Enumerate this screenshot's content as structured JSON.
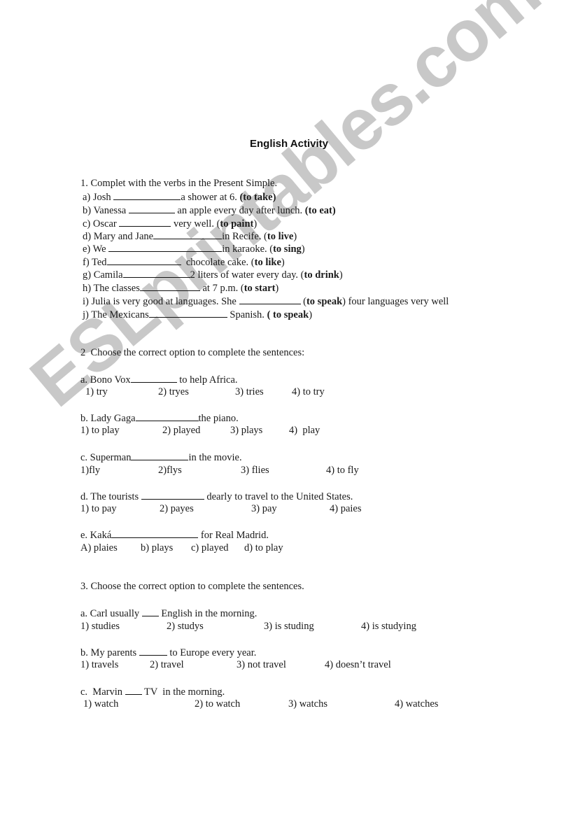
{
  "watermark": "ESLprintables.com",
  "title": "English Activity",
  "section1": {
    "instruction": "1. Complet with the verbs in the Present Simple.",
    "items": [
      {
        "label": "a) Josh ",
        "after": "a shower at 6. ",
        "hint": "(to take)"
      },
      {
        "label": "b) Vanessa ",
        "after": " an apple every day after lunch. ",
        "hint": "(to eat)"
      },
      {
        "label": "c) Oscar ",
        "after": " very well. (",
        "hint": "to paint",
        "close": ")"
      },
      {
        "label": "d) Mary and Jane",
        "after": "in Recife. (",
        "hint": "to live",
        "close": ")"
      },
      {
        "label": "e) We ",
        "after": "in karaoke. (",
        "hint": "to sing",
        "close": ")"
      },
      {
        "label": "f) Ted",
        "after": "  chocolate cake. (",
        "hint": "to like",
        "close": ")"
      },
      {
        "label": "g) Camila",
        "after": "2 liters of water every day. (",
        "hint": "to drink",
        "close": ")"
      },
      {
        "label": "h) The classes",
        "after": " at 7 p.m. (",
        "hint": "to start",
        "close": ")"
      },
      {
        "label": "i) Julia is very good at languages. She ",
        "after": " (",
        "hint": "to speak",
        "close": ") four languages very well"
      },
      {
        "label": "j) The Mexicans",
        "after": " Spanish. ",
        "hint": "( to speak",
        "close": ")"
      }
    ]
  },
  "section2": {
    "instruction": "2  Choose the correct option to complete the sentences:",
    "questions": [
      {
        "before": "a. Bono Vox",
        "after": " to help Africa.",
        "options": [
          "1) try",
          "2) tryes",
          "3) tries",
          "4) to try"
        ]
      },
      {
        "before": "b. Lady Gaga",
        "after": "the piano.",
        "options": [
          "1) to play",
          "2) played",
          "3) plays",
          "4)  play"
        ]
      },
      {
        "before": "c. Superman",
        "after": "in the movie.",
        "options": [
          "1)fly",
          "2)flys",
          "3) flies",
          "4) to fly"
        ]
      },
      {
        "before": "d. The tourists ",
        "after": " dearly to travel to the United States.",
        "options": [
          "1) to pay",
          "2) payes",
          "3) pay",
          "4) paies"
        ]
      },
      {
        "before": "e. Kaká",
        "after": " for Real Madrid.",
        "options": [
          "A) plaies",
          "b) plays",
          "c) played",
          "d) to play"
        ]
      }
    ]
  },
  "section3": {
    "instruction": "3. Choose the correct option to complete the sentences.",
    "questions": [
      {
        "before": "a. Carl usually ",
        "after": " English in the morning.",
        "options": [
          "1) studies",
          "2) studys",
          "3) is studing",
          "4) is studying"
        ]
      },
      {
        "before": "b. My parents ",
        "after": " to Europe every year.",
        "options": [
          "1) travels",
          "2) travel",
          "3) not travel",
          "4) doesn’t travel"
        ]
      },
      {
        "before": "c.  Marvin ",
        "after": " TV  in the morning.",
        "options": [
          "1) watch",
          "2) to watch",
          "3) watchs",
          "4) watches"
        ]
      }
    ]
  }
}
